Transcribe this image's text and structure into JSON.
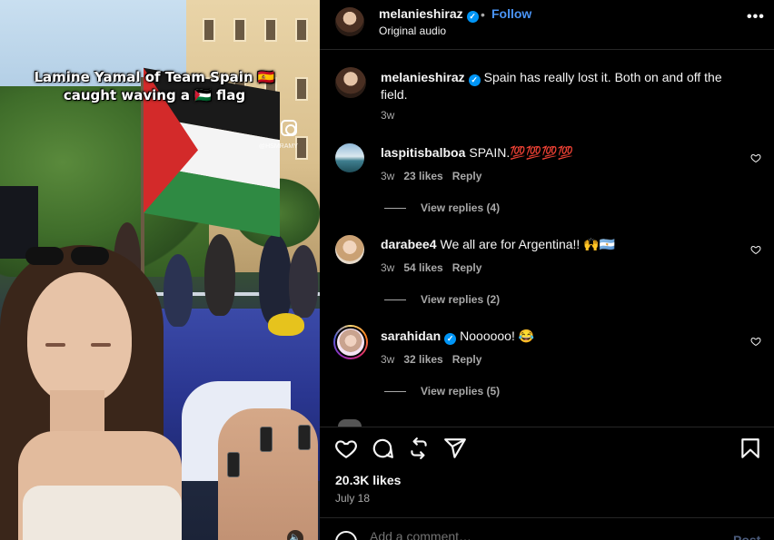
{
  "media": {
    "caption_line1": "Lamine Yamal of Team Spain 🇪🇸",
    "caption_line2": "caught waving a 🇵🇸 flag",
    "watermark": "@HSMRAMY",
    "mute_glyph": "🔈"
  },
  "header": {
    "username": "melanieshiraz",
    "verified_glyph": "✓",
    "dot": "•",
    "follow_label": "Follow",
    "audio": "Original audio",
    "more_glyph": "•••"
  },
  "caption": {
    "username": "melanieshiraz",
    "text": "Spain has really lost it. Both on and off the field.",
    "time": "3w"
  },
  "comments": [
    {
      "username": "laspitisbalboa",
      "verified": false,
      "text": "SPAIN.💯💯💯💯",
      "time": "3w",
      "likes": "23 likes",
      "reply": "Reply",
      "view_replies": "View replies (4)"
    },
    {
      "username": "darabee4",
      "verified": false,
      "text": "We all are for Argentina!! 🙌🇦🇷",
      "time": "3w",
      "likes": "54 likes",
      "reply": "Reply",
      "view_replies": "View replies (2)"
    },
    {
      "username": "sarahidan",
      "verified": true,
      "text": "Noooooo! 😂",
      "time": "3w",
      "likes": "32 likes",
      "reply": "Reply",
      "view_replies": "View replies (5)"
    }
  ],
  "actions": {
    "icons": [
      "heart-icon",
      "comment-icon",
      "repost-icon",
      "share-icon",
      "bookmark-icon"
    ]
  },
  "post_meta": {
    "likes": "20.3K likes",
    "date": "July 18"
  },
  "add_comment": {
    "placeholder": "Add a comment…",
    "post_label": "Post"
  },
  "colors": {
    "background": "#000000",
    "accent": "#4a94f5",
    "verified": "#0095f6",
    "muted": "#a8a8a8"
  }
}
